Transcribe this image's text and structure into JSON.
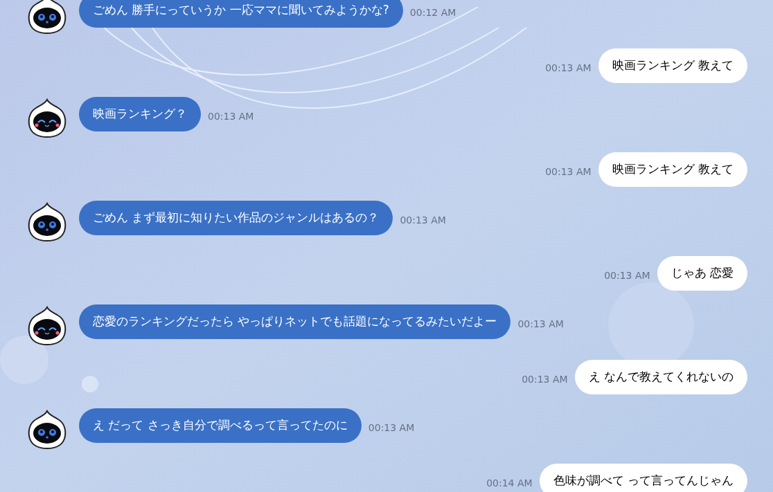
{
  "messages": [
    {
      "kind": "bot",
      "smiling": false,
      "text": "ごめん 勝手にっていうか 一応ママに聞いてみようかな?",
      "time": "00:12 AM"
    },
    {
      "kind": "user",
      "text": "映画ランキング 教えて",
      "time": "00:13 AM"
    },
    {
      "kind": "bot",
      "smiling": true,
      "text": "映画ランキング？",
      "time": "00:13 AM"
    },
    {
      "kind": "user",
      "text": "映画ランキング 教えて",
      "time": "00:13 AM"
    },
    {
      "kind": "bot",
      "smiling": false,
      "text": "ごめん まず最初に知りたい作品のジャンルはあるの？",
      "time": "00:13 AM"
    },
    {
      "kind": "user",
      "text": "じゃあ 恋愛",
      "time": "00:13 AM"
    },
    {
      "kind": "bot",
      "smiling": true,
      "text": "恋愛のランキングだったら やっぱりネットでも話題になってるみたいだよー",
      "time": "00:13 AM"
    },
    {
      "kind": "user",
      "text": "え なんで教えてくれないの",
      "time": "00:13 AM"
    },
    {
      "kind": "bot",
      "smiling": false,
      "text": "え だって さっき自分で調べるって言ってたのに",
      "time": "00:13 AM"
    },
    {
      "kind": "user",
      "text": "色味が調べて って言ってんじゃん",
      "time": "00:14 AM"
    }
  ]
}
